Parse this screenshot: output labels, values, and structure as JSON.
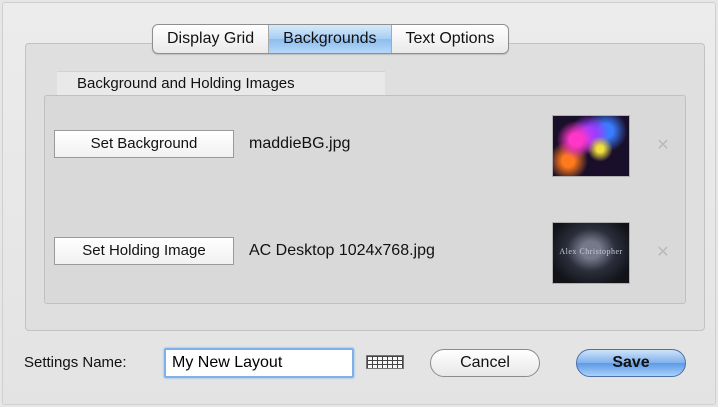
{
  "tabs": [
    {
      "label": "Display Grid",
      "selected": false
    },
    {
      "label": "Backgrounds",
      "selected": true
    },
    {
      "label": "Text Options",
      "selected": false
    }
  ],
  "group": {
    "label": "Background and Holding Images",
    "rows": [
      {
        "button": "Set Background",
        "filename": "maddieBG.jpg",
        "thumbnail": "abstract-colorful-image"
      },
      {
        "button": "Set Holding Image",
        "filename": "AC Desktop 1024x768.jpg",
        "thumbnail": "dark-desktop-image",
        "thumbnail_text": "Alex Christopher"
      }
    ],
    "remove_icon": "remove-x-icon"
  },
  "footer": {
    "settings_label": "Settings Name:",
    "settings_value": "My New Layout",
    "keyboard_icon": "keyboard-icon",
    "cancel_label": "Cancel",
    "save_label": "Save"
  },
  "colors": {
    "selected_tab": "#a6cdf3",
    "default_button": "#5d9ae6",
    "focus_ring": "#7eb1ea"
  }
}
